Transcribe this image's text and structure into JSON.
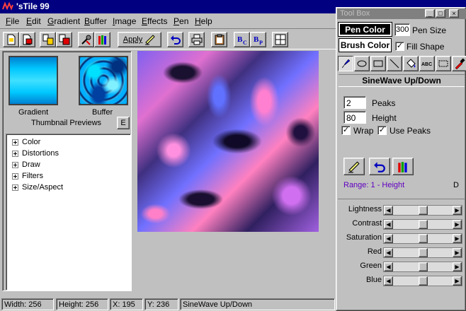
{
  "window": {
    "title": "'sTile 99"
  },
  "menu": [
    "File",
    "Edit",
    "Gradient",
    "Buffer",
    "Image",
    "Effects",
    "Pen",
    "Help"
  ],
  "menu_mnemonic": [
    "F",
    "E",
    "G",
    "B",
    "I",
    "E",
    "P",
    "H"
  ],
  "toolbar": {
    "apply_label": "Apply"
  },
  "left_panel": {
    "gradient_label": "Gradient",
    "buffer_label": "Buffer",
    "thumbnail_label": "Thumbnail Previews",
    "e_button": "E",
    "tree": [
      "Color",
      "Distortions",
      "Draw",
      "Filters",
      "Size/Aspect"
    ]
  },
  "toolbox": {
    "title": "Tool Box",
    "pen_color": "Pen Color",
    "pen_size_value": "300",
    "pen_size_label": "Pen Size",
    "brush_color": "Brush Color",
    "fill_shape_label": "Fill Shape",
    "fill_shape_checked": true,
    "tool_abc": "ABC",
    "effect_title": "SineWave Up/Down",
    "peaks_value": "2",
    "peaks_label": "Peaks",
    "height_value": "80",
    "height_label": "Height",
    "wrap_label": "Wrap",
    "wrap_checked": true,
    "use_peaks_label": "Use Peaks",
    "use_peaks_checked": true,
    "range_text": "Range: 1 - Height",
    "range_suffix": "D",
    "sliders": [
      {
        "label": "Lightness",
        "level": 0.5
      },
      {
        "label": "Contrast",
        "level": 0.5
      },
      {
        "label": "Saturation",
        "level": 0.5
      },
      {
        "label": "Red",
        "level": 0.5
      },
      {
        "label": "Green",
        "level": 0.5
      },
      {
        "label": "Blue",
        "level": 0.5
      }
    ]
  },
  "status": {
    "width": "Width: 256",
    "height": "Height: 256",
    "x": "X: 195",
    "y": "Y: 236",
    "effect": "SineWave Up/Down"
  },
  "colors": {
    "title_active": "#000080",
    "face": "#c0c0c0",
    "range_text": "#6000c0"
  }
}
